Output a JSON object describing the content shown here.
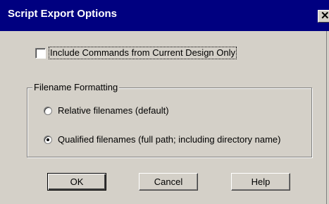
{
  "window": {
    "title": "Script Export Options",
    "close_glyph": "✕"
  },
  "options": {
    "include_commands_label": "Include Commands from Current Design Only",
    "include_commands_checked": false
  },
  "filename_group": {
    "legend": "Filename Formatting",
    "radios": [
      {
        "label": "Relative filenames (default)",
        "selected": false
      },
      {
        "label": "Qualified filenames (full path; including directory name)",
        "selected": true
      }
    ]
  },
  "buttons": {
    "ok": "OK",
    "cancel": "Cancel",
    "help": "Help"
  }
}
